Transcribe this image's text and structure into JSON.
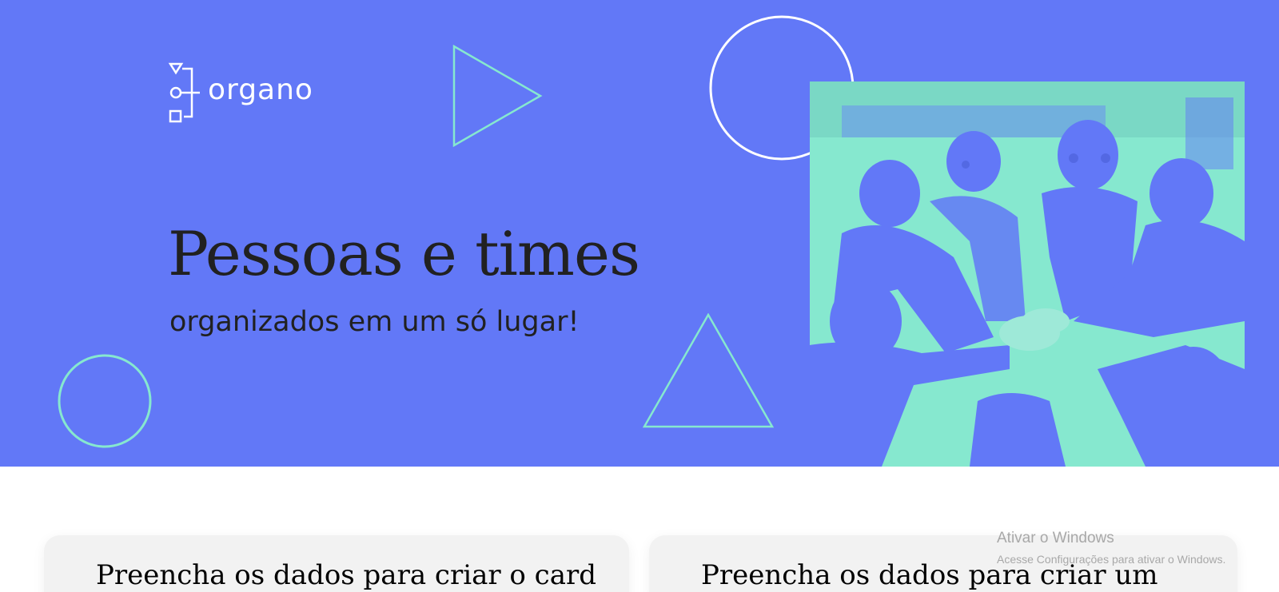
{
  "banner": {
    "logo_text": "organo",
    "headline": "Pessoas e times",
    "subheadline": "organizados em um só lugar!",
    "photo_description_icon": "team-hands-together-photo",
    "background_color": "#6278f7",
    "accent_color": "#86e8cf"
  },
  "forms": {
    "left_title": "Preencha os dados para criar o card",
    "right_title": "Preencha os dados para criar um"
  },
  "watermark": {
    "title": "Ativar o Windows",
    "subtitle": "Acesse Configurações para ativar o Windows."
  }
}
